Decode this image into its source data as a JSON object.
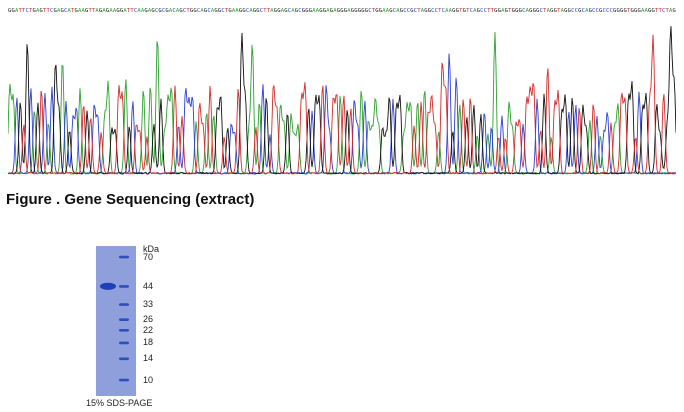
{
  "sequence_strip": {
    "bases": "GGATTCTGAGTTCGAGCATGAAGTTAGAGAAGGATTCAAGAGCGCGACAGCTGGCAGCAGGCTGAAGGCAGGCTTAGGAGCAGCGGGAAGGAGAGGGAGGGGGCTGGAAGCAGCCGCTAGGCCTCAAGGTGTCAGCCTTGGAGTGGGCAGGGCTAGGTAGGCCGCAGCCGCCCGGGGTGGGAAGGTTCTAG",
    "colors": {
      "A": "#2fa02f",
      "C": "#2a3fd6",
      "G": "#111111",
      "T": "#d62a2a"
    }
  },
  "chromatogram": {
    "channel_colors": {
      "A": "#2fa02f",
      "C": "#2a3fd6",
      "G": "#111111",
      "T": "#d62a2a"
    },
    "base_count": 190,
    "random_seed": 7
  },
  "figure_caption": "Figure . Gene Sequencing (extract)",
  "gel": {
    "unit_label": "kDa",
    "ladder": [
      70,
      44,
      33,
      26,
      22,
      18,
      14,
      10
    ],
    "sample_band_kda": 44,
    "caption": "15% SDS-PAGE",
    "lane_color": "#8f9fdc",
    "band_color": "#1d3fb8"
  }
}
